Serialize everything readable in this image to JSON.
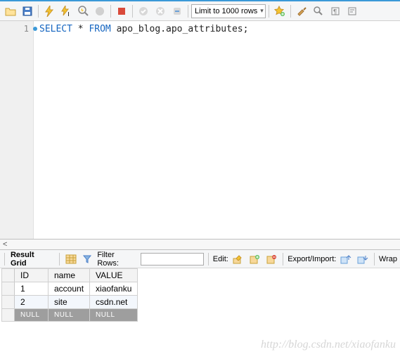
{
  "toolbar": {
    "limit_label": "Limit to 1000 rows"
  },
  "editor": {
    "line_no": "1",
    "kw_select": "SELECT",
    "star": " * ",
    "kw_from": "FROM",
    "rest": " apo_blog.apo_attributes;"
  },
  "splitter_hint": "<",
  "results": {
    "grid_label": "Result Grid",
    "filter_label": "Filter Rows:",
    "filter_value": "",
    "edit_label": "Edit:",
    "export_label": "Export/Import:",
    "wrap_label": "Wrap",
    "columns": {
      "c0": "ID",
      "c1": "name",
      "c2": "VALUE"
    },
    "rows": [
      {
        "id": "1",
        "name": "account",
        "value": "xiaofanku"
      },
      {
        "id": "2",
        "name": "site",
        "value": "csdn.net"
      }
    ],
    "null_text": "NULL"
  },
  "watermark": "http://blog.csdn.net/xiaofanku"
}
